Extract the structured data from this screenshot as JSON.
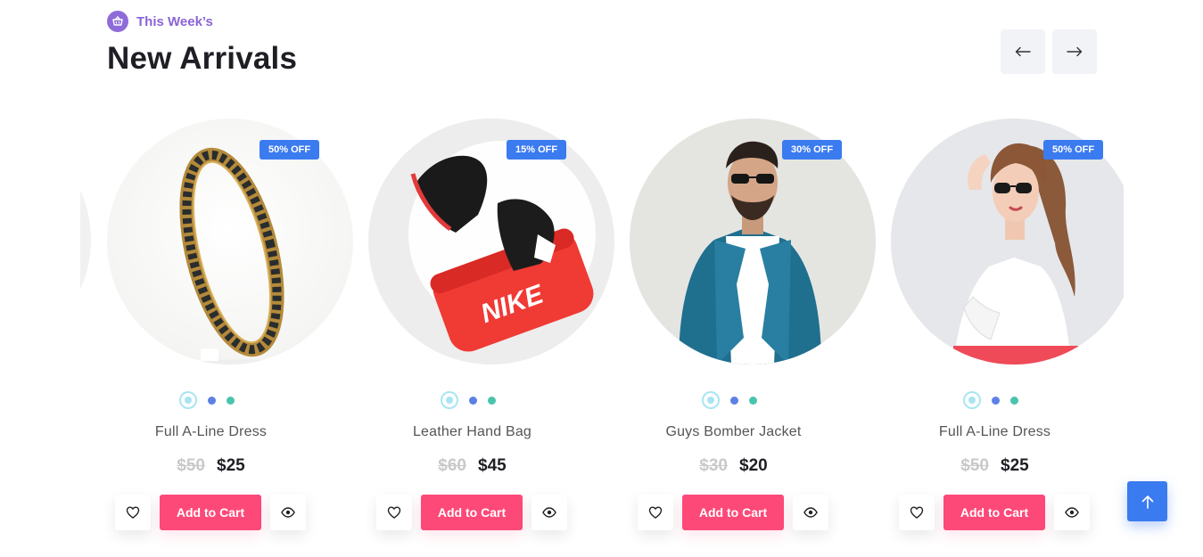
{
  "header": {
    "eyebrow_icon": "basket-icon",
    "eyebrow": "This Week’s",
    "title": "New Arrivals"
  },
  "nav": {
    "prev_icon": "arrow-left-icon",
    "next_icon": "arrow-right-icon"
  },
  "products": [
    {
      "name": "Full A-Line Dress",
      "old_price": "$50",
      "price": "$25",
      "discount": "50% OFF",
      "image": "gold-bangle-bracelet",
      "cart_label": "Add to Cart"
    },
    {
      "name": "Leather Hand Bag",
      "old_price": "$60",
      "price": "$45",
      "discount": "15% OFF",
      "image": "sneakers-in-red-bag",
      "cart_label": "Add to Cart"
    },
    {
      "name": "Guys Bomber Jacket",
      "old_price": "$30",
      "price": "$20",
      "discount": "30% OFF",
      "image": "man-in-denim-jacket",
      "cart_label": "Add to Cart"
    },
    {
      "name": "Full A-Line Dress",
      "old_price": "$50",
      "price": "$25",
      "discount": "50% OFF",
      "image": "woman-in-white-top",
      "cart_label": "Add to Cart"
    }
  ],
  "swatch_colors": [
    "#a8e5f1",
    "#5d80e4",
    "#49c4ad"
  ],
  "colors": {
    "accent_purple": "#8a64d6",
    "badge_blue": "#3b7bf0",
    "cart_pink": "#fd4978"
  },
  "back_to_top_icon": "arrow-up-icon"
}
